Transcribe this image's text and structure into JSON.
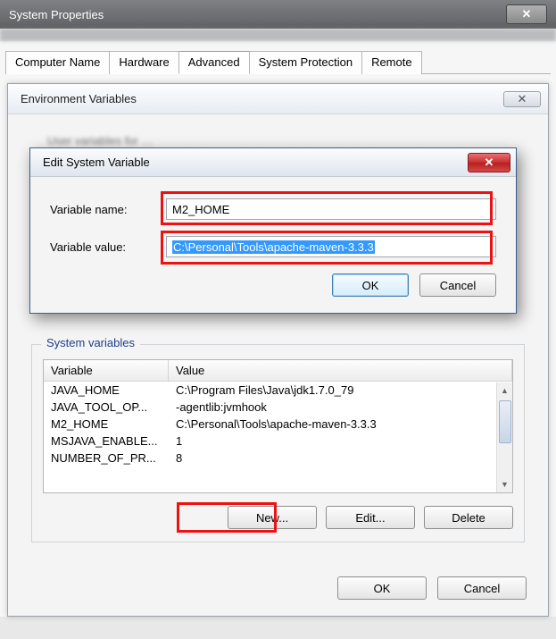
{
  "outer": {
    "title": "System Properties"
  },
  "tabs": [
    "Computer Name",
    "Hardware",
    "Advanced",
    "System Protection",
    "Remote"
  ],
  "active_tab": 2,
  "env": {
    "title": "Environment Variables",
    "user_section_blurred": "User variables for …",
    "sys_legend": "System variables",
    "columns": {
      "name": "Variable",
      "value": "Value"
    },
    "rows": [
      {
        "name": "JAVA_HOME",
        "value": "C:\\Program Files\\Java\\jdk1.7.0_79"
      },
      {
        "name": "JAVA_TOOL_OP...",
        "value": "-agentlib:jvmhook"
      },
      {
        "name": "M2_HOME",
        "value": "C:\\Personal\\Tools\\apache-maven-3.3.3"
      },
      {
        "name": "MSJAVA_ENABLE...",
        "value": "1"
      },
      {
        "name": "NUMBER_OF_PR...",
        "value": "8"
      }
    ],
    "buttons": {
      "new": "New...",
      "edit": "Edit...",
      "del": "Delete"
    },
    "footer": {
      "ok": "OK",
      "cancel": "Cancel"
    }
  },
  "edit": {
    "title": "Edit System Variable",
    "name_label": "Variable name:",
    "value_label": "Variable value:",
    "name": "M2_HOME",
    "value": "C:\\Personal\\Tools\\apache-maven-3.3.3",
    "ok": "OK",
    "cancel": "Cancel"
  }
}
